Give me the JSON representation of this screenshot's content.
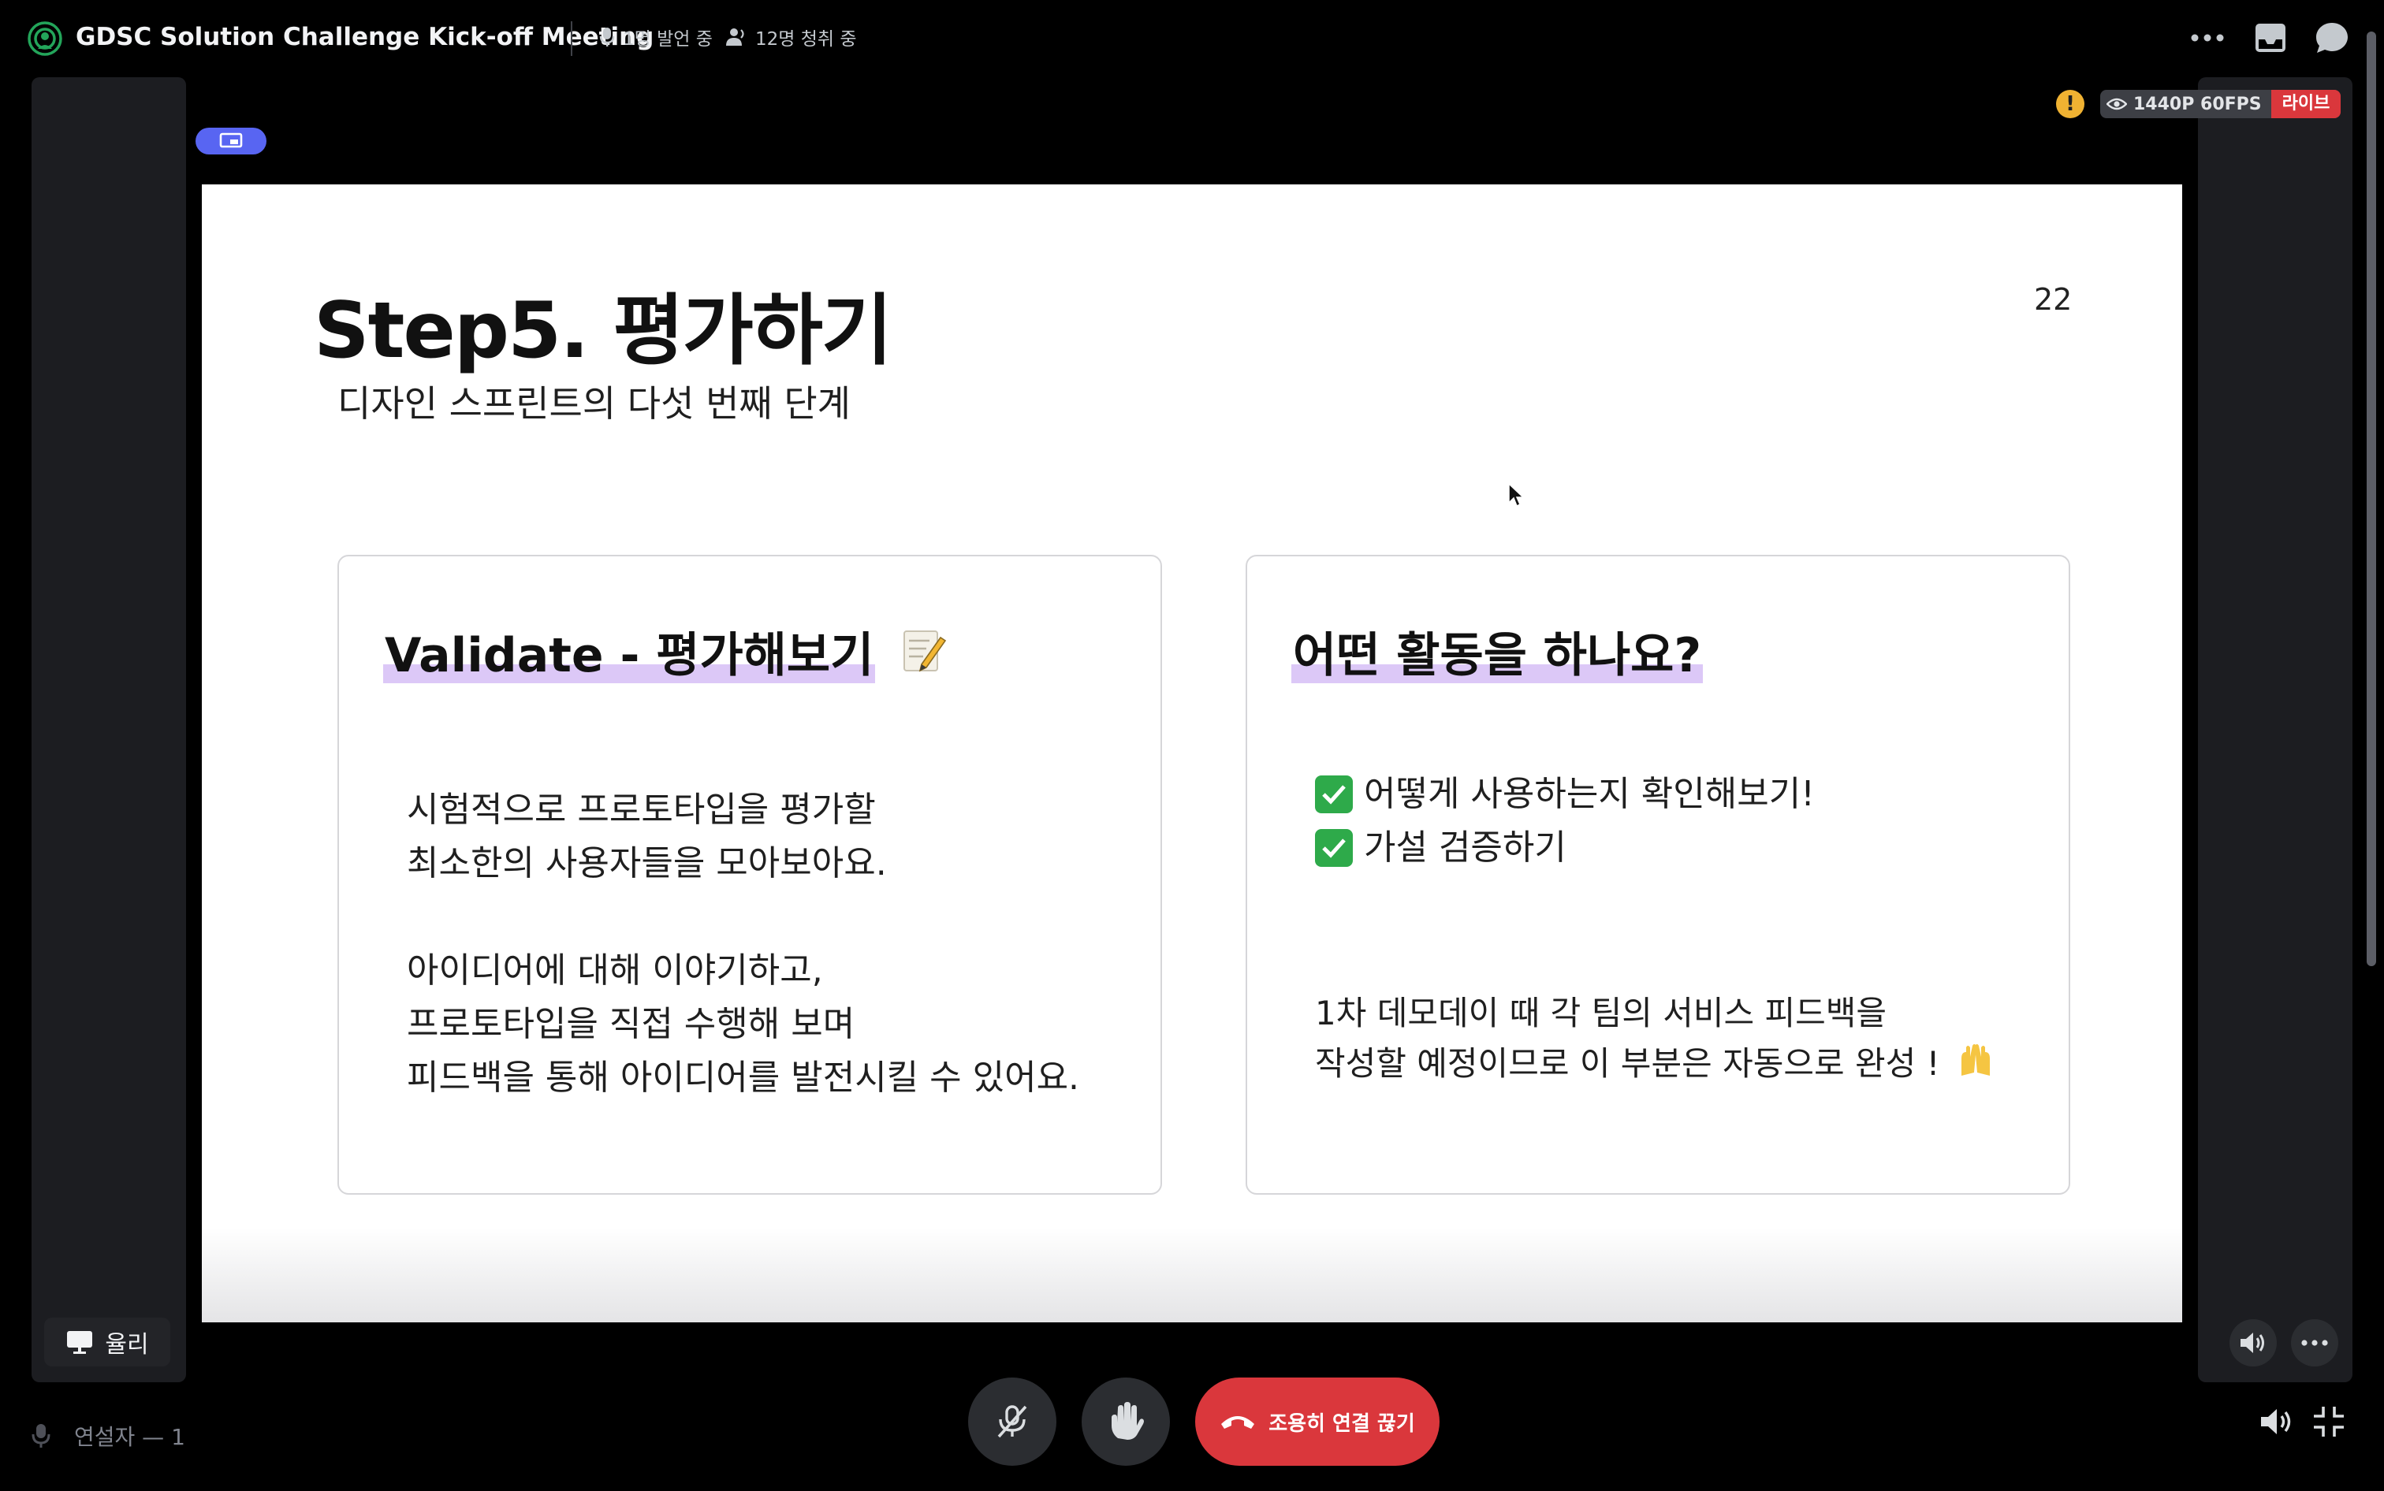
{
  "header": {
    "title": "GDSC Solution Challenge Kick-off Meeting",
    "speakers_status": "1명 발언 중",
    "listeners_status": "12명 청취 중"
  },
  "stream": {
    "quality": "1440P 60FPS",
    "live_label": "라이브"
  },
  "presenter": {
    "name": "율리"
  },
  "slide": {
    "title": "Step5. 평가하기",
    "subtitle": "디자인 스프린트의 다섯 번째 단계",
    "page_number": "22",
    "left_card": {
      "heading": "Validate - 평가해보기",
      "lines": [
        "시험적으로 프로토타입을 평가할",
        "최소한의 사용자들을 모아보아요.",
        "아이디어에 대해 이야기하고,",
        "프로토타입을 직접 수행해 보며",
        "피드백을 통해 아이디어를 발전시킬 수 있어요."
      ]
    },
    "right_card": {
      "heading": "어떤 활동을 하나요?",
      "checks": [
        "어떻게 사용하는지 확인해보기!",
        "가설 검증하기"
      ],
      "note_lines": [
        "1차 데모데이 때 각 팀의 서비스 피드백을",
        "작성할 예정이므로 이 부분은 자동으로 완성 !"
      ]
    }
  },
  "controls": {
    "leave_label": "조용히 연결 끊기"
  },
  "footer": {
    "speakers_count": "연설자 — 1"
  },
  "icons": {
    "stage": "stage-channel-icon",
    "mic": "microphone-icon",
    "listeners": "listeners-icon",
    "more": "more-horizontal-icon",
    "inbox": "inbox-icon",
    "chat": "chat-bubble-icon",
    "screen": "screen-share-icon",
    "warning": "warning-icon",
    "eye": "stream-quality-eye-icon",
    "volume": "volume-icon",
    "exit_fullscreen": "exit-fullscreen-icon",
    "mute": "mic-muted-icon",
    "raise_hand": "raise-hand-icon",
    "hangup": "hangup-icon"
  },
  "colors": {
    "accent": "#5865f2",
    "danger": "#da373c",
    "warning": "#f0b232",
    "highlight": "#dcc8f7",
    "check": "#2eaa4a"
  }
}
